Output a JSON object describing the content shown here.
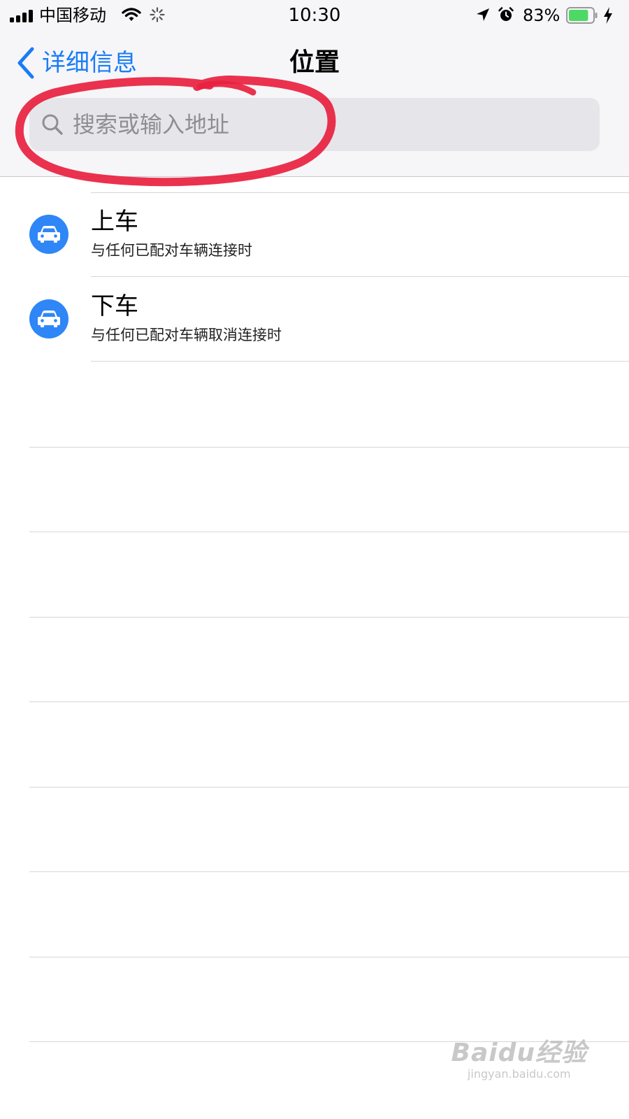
{
  "status_bar": {
    "carrier": "中国移动",
    "time": "10:30",
    "battery_percent": "83%",
    "battery_level": 0.83,
    "icons": [
      "signal-icon",
      "wifi-icon",
      "activity-icon",
      "location-icon",
      "alarm-icon",
      "battery-icon",
      "charging-icon"
    ]
  },
  "nav": {
    "back_label": "详细信息",
    "title": "位置"
  },
  "search": {
    "placeholder": "搜索或输入地址",
    "value": ""
  },
  "list": {
    "items": [
      {
        "icon": "car-icon",
        "title": "上车",
        "subtitle": "与任何已配对车辆连接时"
      },
      {
        "icon": "car-icon",
        "title": "下车",
        "subtitle": "与任何已配对车辆取消连接时"
      }
    ]
  },
  "watermark": {
    "logo": "Baidu经验",
    "url": "jingyan.baidu.com"
  },
  "colors": {
    "accent": "#1a7cf6",
    "icon_badge": "#2f86f6",
    "annotation": "#e8213f",
    "battery": "#4cd964"
  }
}
